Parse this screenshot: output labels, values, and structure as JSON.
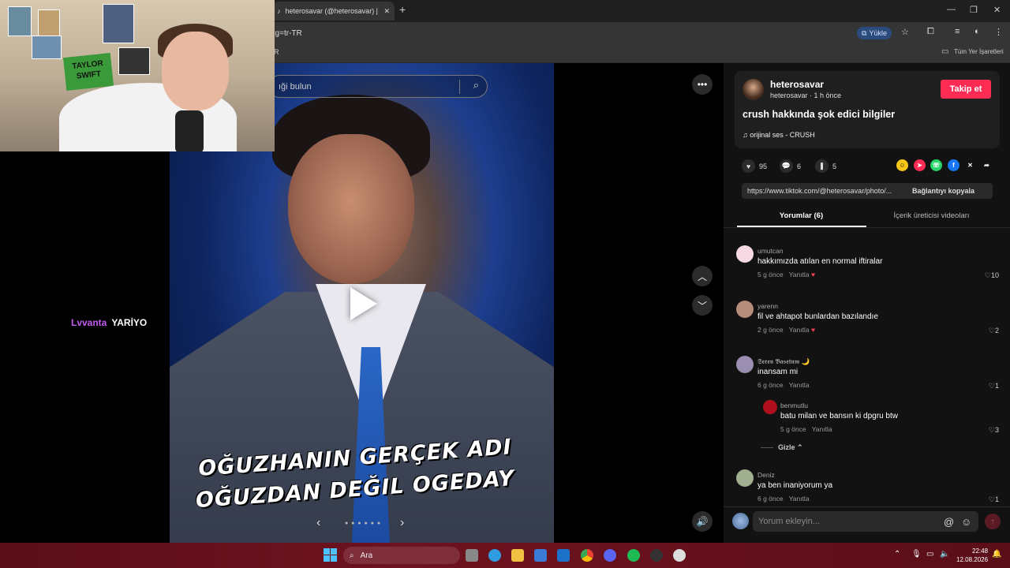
{
  "browser": {
    "tab_title": "heterosavar (@heterosavar) | TikTok",
    "url_fragment": "ng=tr-TR",
    "install_label": "Yükle",
    "bookmarks_left": "R",
    "bookmarks_all": "Tüm Yer İşaretleri"
  },
  "video": {
    "search_placeholder": "ıği bulun",
    "caption_line1": "OĞUZHANIN GERÇEK ADI",
    "caption_line2": "OĞUZDAN DEĞIL OGEDAY",
    "overlay_user": "Lvvanta",
    "overlay_msg": "YARİYO",
    "webcam_sign": "TAYLOR SWIFT"
  },
  "post": {
    "username": "heterosavar",
    "subline": "heterosavar · 1 h önce",
    "follow_label": "Takip et",
    "title": "crush hakkında şok edici bilgiler",
    "music": "orijinal ses - CRUSH",
    "likes": "95",
    "comments": "6",
    "saves": "5",
    "link": "https://www.tiktok.com/@heterosavar/photo/...",
    "copy_label": "Bağlantıyı kopyala",
    "tab_comments": "Yorumlar (6)",
    "tab_creator": "İçerik üreticisi videoları"
  },
  "comments": [
    {
      "user": "umutcan",
      "text": "hakkımızda atılan en normal iftiralar",
      "time": "5 g önce",
      "reply": "Yanıtla",
      "likes": "10",
      "avatar_color": "#f7d9e3"
    },
    {
      "user": "yarenn",
      "text": "fil ve ahtapot bunlardan bazılandıe",
      "time": "2 g önce",
      "reply": "Yanıtla",
      "likes": "2",
      "avatar_color": "#b48c78"
    },
    {
      "user": "𝕾𝖊𝖗𝖊𝖓 𝕭𝖆𝖘𝖊𝖙𝖓𝖒 🌙",
      "text": "inansam mi",
      "time": "6 g önce",
      "reply": "Yanıtla",
      "likes": "1",
      "avatar_color": "#9a8fb0"
    },
    {
      "user": "benmutlu",
      "text": "batu milan ve bansın ki dpgru btw",
      "time": "5 g önce",
      "reply": "Yanıtla",
      "likes": "3",
      "avatar_color": "#b0101e"
    },
    {
      "user": "Deniz",
      "text": "ya ben inaniyorum ya",
      "time": "6 g önce",
      "reply": "Yanıtla",
      "likes": "1",
      "avatar_color": "#a0b090"
    }
  ],
  "hide_label": "Gizle",
  "comment_placeholder": "Yorum ekleyin...",
  "taskbar": {
    "search_label": "Ara",
    "time": "22:48",
    "date": "12.08.2026"
  }
}
